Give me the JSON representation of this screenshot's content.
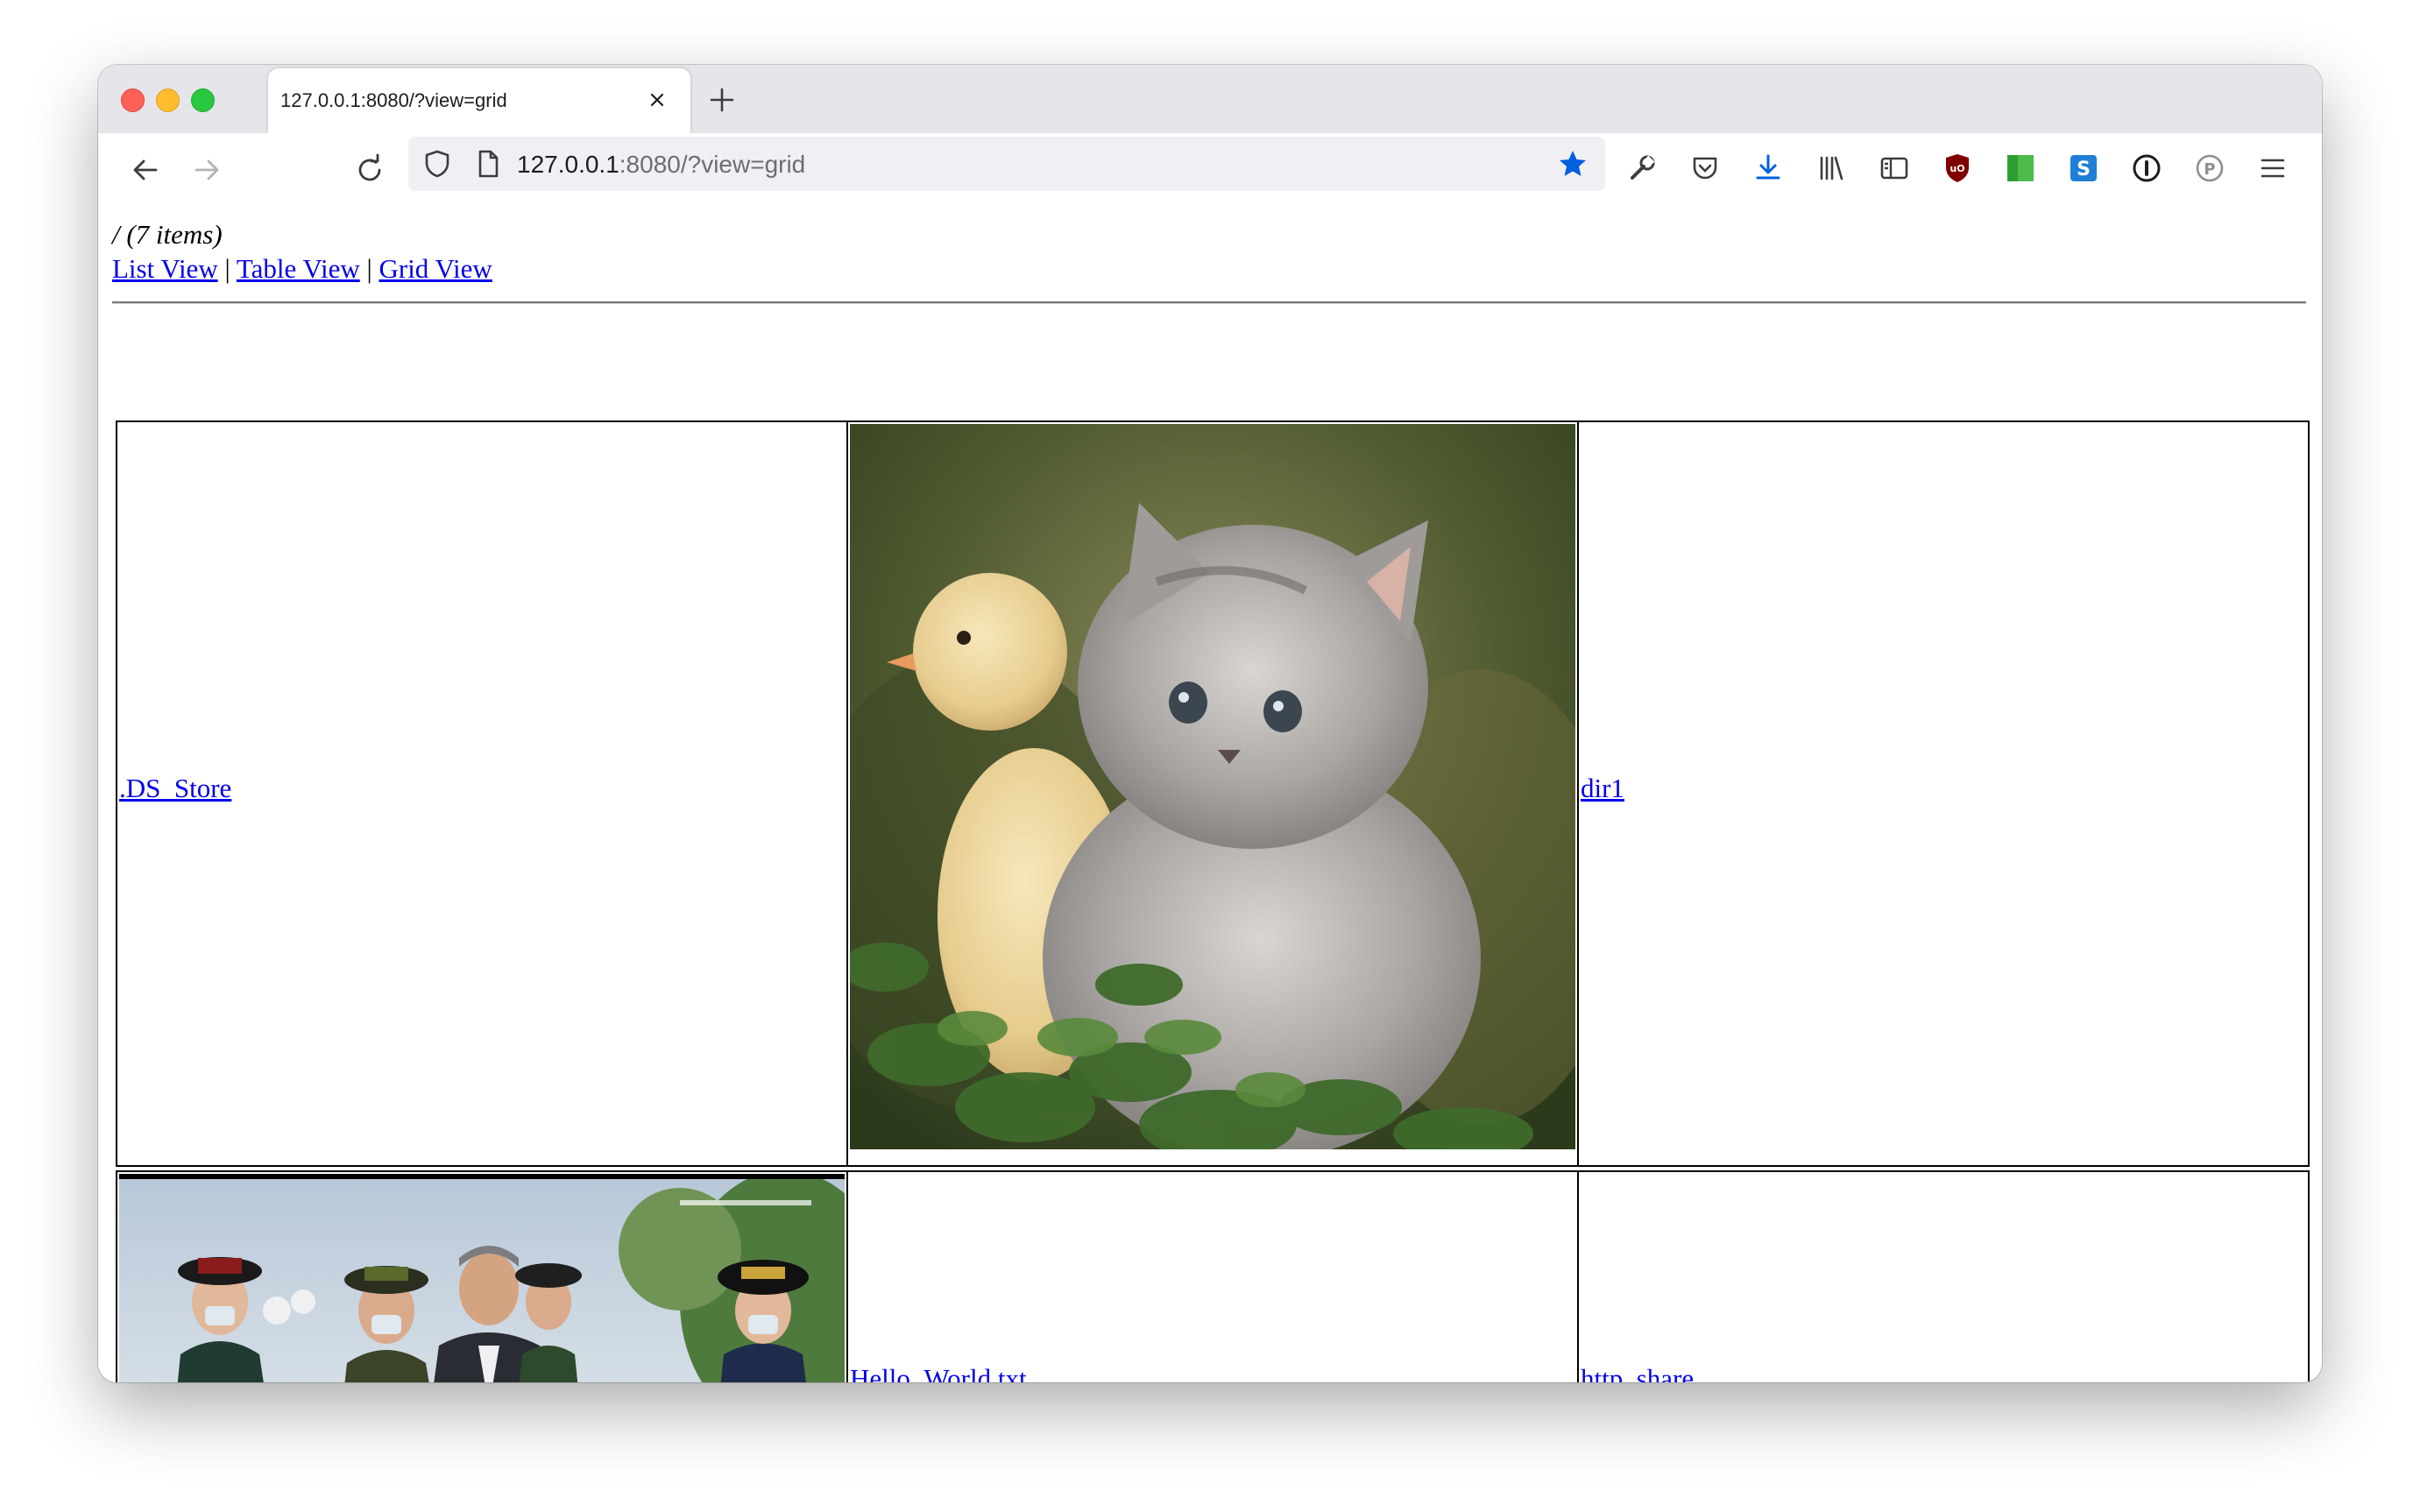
{
  "browser": {
    "tab_title": "127.0.0.1:8080/?view=grid",
    "url_host": "127.0.0.1",
    "url_rest": ":8080/?view=grid"
  },
  "page": {
    "heading": "/ (7 items)",
    "views": [
      "List View",
      "Table View",
      "Grid View"
    ],
    "separator": "|",
    "items": [
      {
        "name": ".DS_Store",
        "type": "file"
      },
      {
        "name": "kitten-and-chick",
        "type": "image",
        "alt": ""
      },
      {
        "name": "dir1",
        "type": "folder"
      },
      {
        "name": "officials-photo",
        "type": "image",
        "alt": ""
      },
      {
        "name": "Hello_World.txt",
        "type": "file"
      },
      {
        "name": "http_share",
        "type": "folder"
      }
    ]
  },
  "colors": {
    "link": "#0000ee",
    "bookmark_star": "#0060df",
    "download_icon": "#0060df"
  }
}
